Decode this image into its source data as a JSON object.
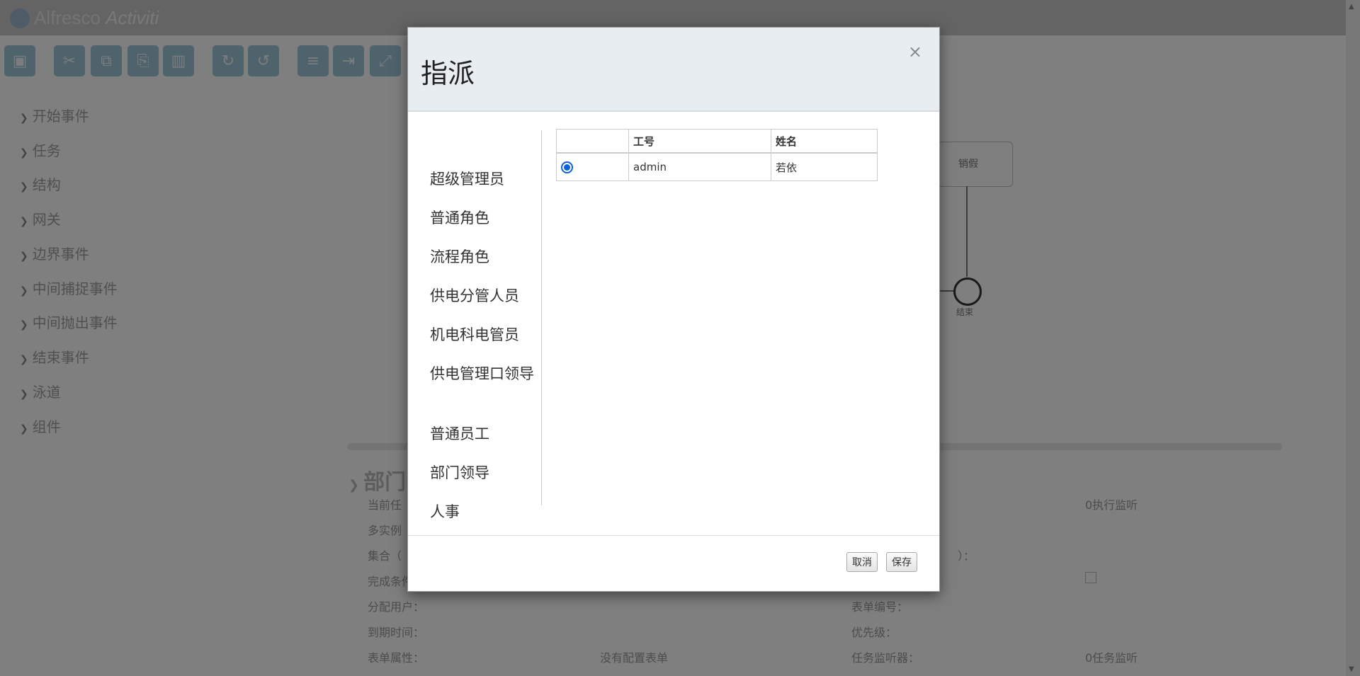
{
  "app": {
    "logo_text_1": "Alfresco",
    "logo_text_2": "Activiti"
  },
  "palette": {
    "items": [
      "开始事件",
      "任务",
      "结构",
      "网关",
      "边界事件",
      "中间捕捉事件",
      "中间抛出事件",
      "结束事件",
      "泳道",
      "组件"
    ]
  },
  "canvas": {
    "task_label": "销假",
    "end_label": "结束"
  },
  "properties": {
    "section_title": "部门",
    "left_labels": [
      "当前任",
      "多实例",
      "集合（",
      "完成条件",
      "分配用户：",
      "到期时间：",
      "表单属性："
    ],
    "right_labels": [
      "表单编号：",
      "优先级：",
      "任务监听器："
    ],
    "right_values": [
      "0执行监听",
      "0任务监听"
    ],
    "form_props_value": "没有配置表单",
    "collection_suffix": "）："
  },
  "modal": {
    "title": "指派",
    "close_symbol": "×",
    "roles": [
      "超级管理员",
      "普通角色",
      "流程角色",
      "供电分管人员",
      "机电科电管员",
      "供电管理口领导",
      "普通员工",
      "部门领导",
      "人事"
    ],
    "table": {
      "headers": [
        "",
        "工号",
        "姓名"
      ],
      "rows": [
        {
          "selected": true,
          "id": "admin",
          "name": "若依"
        }
      ]
    },
    "buttons": {
      "cancel": "取消",
      "save": "保存"
    }
  }
}
